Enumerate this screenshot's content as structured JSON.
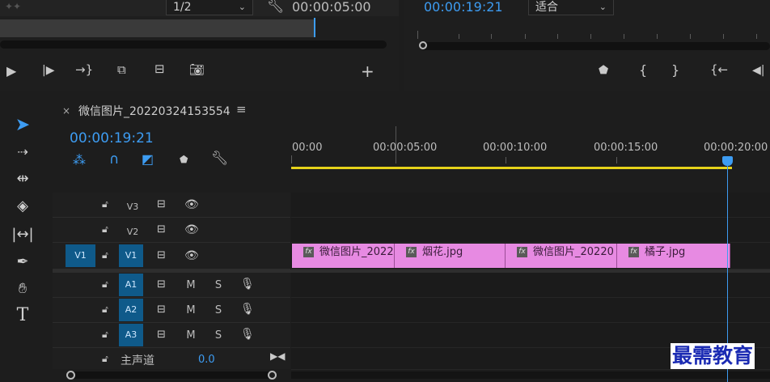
{
  "source_monitor": {
    "resolution": "1/2",
    "duration": "00:00:05:00"
  },
  "program_monitor": {
    "timecode": "00:00:19:21",
    "fit": "适合"
  },
  "timeline": {
    "sequence_name": "微信图片_20220324153554",
    "timecode": "00:00:19:21",
    "ruler": [
      "00:00",
      "00:00:05:00",
      "00:00:10:00",
      "00:00:15:00",
      "00:00:20:00"
    ],
    "video_tracks": [
      {
        "name": "V3",
        "target": ""
      },
      {
        "name": "V2",
        "target": ""
      },
      {
        "name": "V1",
        "target": "V1"
      }
    ],
    "audio_tracks": [
      {
        "name": "A1",
        "m": "M",
        "s": "S"
      },
      {
        "name": "A2",
        "m": "M",
        "s": "S"
      },
      {
        "name": "A3",
        "m": "M",
        "s": "S"
      }
    ],
    "master": {
      "label": "主声道",
      "value": "0.0"
    },
    "clips": [
      {
        "label": "微信图片_2022"
      },
      {
        "label": "烟花.jpg"
      },
      {
        "label": "微信图片_20220"
      },
      {
        "label": "橘子.jpg"
      }
    ]
  },
  "watermark": "最需教育",
  "colors": {
    "accent": "#3d9cf2",
    "clip": "#e78ae2",
    "work_area": "#e6d21a",
    "track_target": "#0f5a8a"
  }
}
